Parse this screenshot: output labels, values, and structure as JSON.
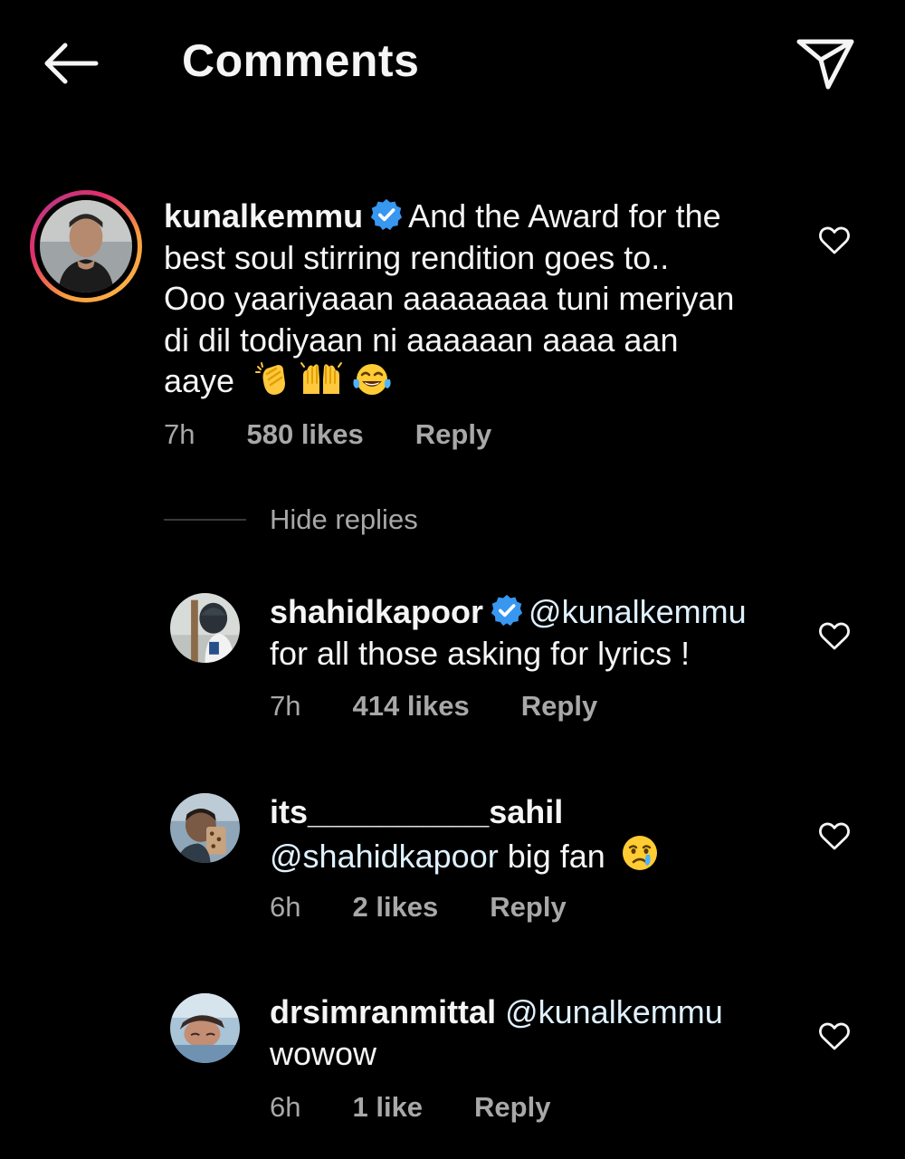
{
  "header": {
    "title": "Comments",
    "back_icon": "arrow-left-icon",
    "share_icon": "paper-plane-icon"
  },
  "main_comment": {
    "username": "kunalkemmu",
    "verified": true,
    "text_line1": "And the Award for the",
    "text_line2": "best soul  stirring rendition goes to..",
    "text_line3": "Ooo yaariyaaan aaaaaaaa tuni meriyan",
    "text_line4": "di dil todiyaan ni aaaaaan aaaa aan",
    "text_line5": "aaye",
    "emojis": [
      "clapping-hands-emoji",
      "raising-hands-emoji",
      "tears-of-joy-emoji"
    ],
    "time": "7h",
    "likes": "580 likes",
    "reply_label": "Reply"
  },
  "hide_replies_label": "Hide replies",
  "replies": [
    {
      "username": "shahidkapoor",
      "verified": true,
      "mention": "@kunalkemmu",
      "text": "for all those asking for lyrics !",
      "time": "7h",
      "likes": "414 likes",
      "reply_label": "Reply"
    },
    {
      "username": "its__________sahil",
      "verified": false,
      "mention": "@shahidkapoor",
      "text": "big fan",
      "emoji": "crying-face-emoji",
      "time": "6h",
      "likes": "2 likes",
      "reply_label": "Reply"
    },
    {
      "username": "drsimranmittal",
      "verified": false,
      "mention": "@kunalkemmu",
      "text": "wowow",
      "time": "6h",
      "likes": "1 like",
      "reply_label": "Reply"
    }
  ],
  "colors": {
    "background": "#000000",
    "text": "#f5f5f5",
    "secondary_text": "#a8a8a8",
    "verified_badge": "#3897f0"
  }
}
